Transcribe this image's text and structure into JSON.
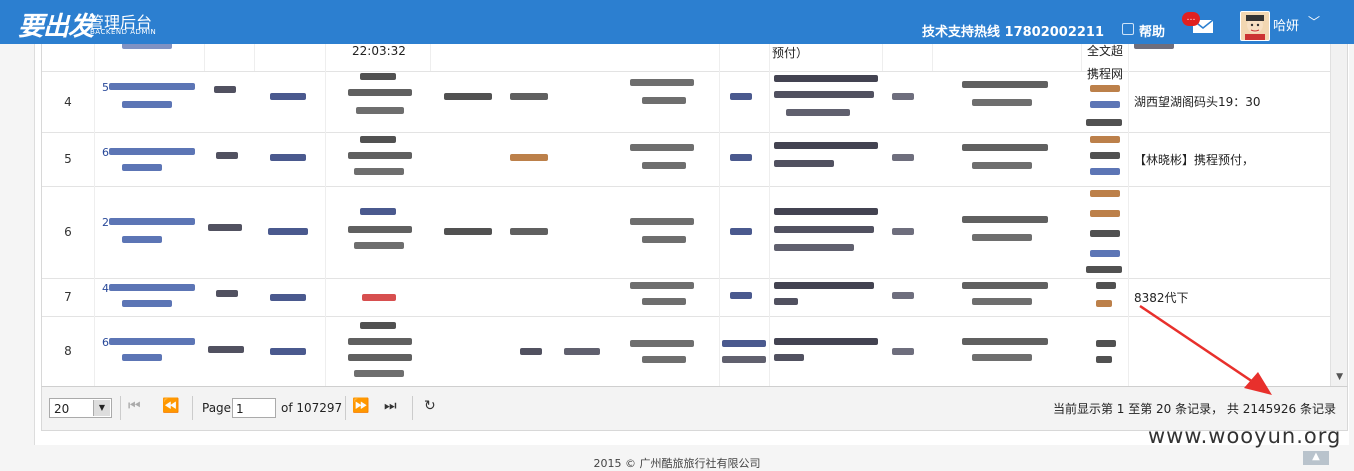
{
  "header": {
    "logo": "要出发",
    "brand_main": "管理后台",
    "brand_sub": "BACKEND ADMIN",
    "hotline": "技术支持热线 17802002211",
    "help_label": "帮助",
    "badge": "…",
    "username": "哈妍",
    "icons": {
      "help": "help-icon",
      "mail": "mail-icon",
      "caret": "chevron-down-icon"
    }
  },
  "grid": {
    "top_partial": {
      "time": "22:03:32",
      "note": "预付）",
      "ticket_head": "全文超"
    },
    "rows": [
      {
        "num": "4",
        "tail": "湖西望湖阁码头19：30",
        "ticket_top": "携程网"
      },
      {
        "num": "5",
        "tail": "【林晓彬】携程预付，"
      },
      {
        "num": "6",
        "tail": ""
      },
      {
        "num": "7",
        "tail": "8382代下"
      },
      {
        "num": "8",
        "tail": ""
      }
    ],
    "prefix_digits": [
      "5",
      "6",
      "2",
      "4",
      "6"
    ]
  },
  "pager": {
    "page_size": "20",
    "page_label": "Page",
    "page_value": "1",
    "of_label": "of 107297",
    "summary": "当前显示第 1 至第 20 条记录， 共 2145926 条记录"
  },
  "footer": {
    "copyright": "2015 © 广州酷旅旅行社有限公司"
  },
  "watermark": "www.wooyun.org",
  "colors": {
    "topbar": "#2c7fd0",
    "arrow": "#e8302c"
  }
}
